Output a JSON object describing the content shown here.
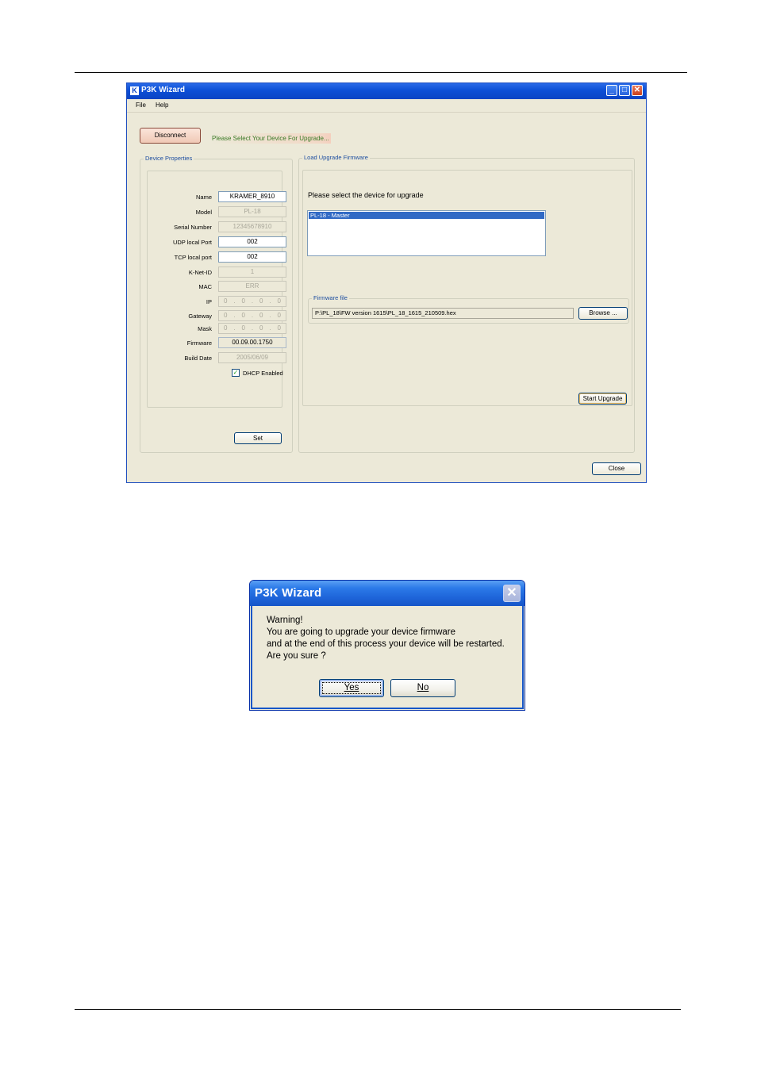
{
  "main_window": {
    "title": "P3K Wizard",
    "menu": [
      "File",
      "Help"
    ],
    "disconnect_label": "Disconnect",
    "status_text": "Please Select Your Device For Upgrade...",
    "device_properties": {
      "legend": "Device Properties",
      "fields": [
        {
          "label": "Name",
          "value": "KRAMER_8910"
        },
        {
          "label": "Model",
          "value": "PL-18"
        },
        {
          "label": "Serial Number",
          "value": "12345678910"
        },
        {
          "label": "UDP local Port",
          "value": "002"
        },
        {
          "label": "TCP local port",
          "value": "002"
        },
        {
          "label": "K-Net-ID",
          "value": "1"
        },
        {
          "label": "MAC",
          "value": "ERR"
        },
        {
          "label": "IP",
          "value": ""
        },
        {
          "label": "Gateway",
          "value": ""
        },
        {
          "label": "Mask",
          "value": ""
        },
        {
          "label": "Firmware",
          "value": "00.09.00.1750"
        },
        {
          "label": "Build Date",
          "value": "2005/06/09"
        }
      ],
      "dhcp_label": "DHCP Enabled",
      "dhcp_checked": true,
      "set_label": "Set"
    },
    "load_upgrade": {
      "legend": "Load Upgrade Firmware",
      "prompt": "Please select the device for upgrade",
      "devices": [
        "PL-18 - Master"
      ],
      "firmware_legend": "Firmware file",
      "firmware_path": "P:\\PL_18\\FW version 1615\\PL_18_1615_210509.hex",
      "browse_label": "Browse ...",
      "start_label": "Start Upgrade"
    },
    "close_label": "Close"
  },
  "dialog": {
    "title": "P3K Wizard",
    "lines": [
      "Warning!",
      "You are going to upgrade your device firmware",
      "and at the end of this process your device will be restarted.",
      "Are you sure ?"
    ],
    "yes_label": "Yes",
    "no_label": "No"
  }
}
